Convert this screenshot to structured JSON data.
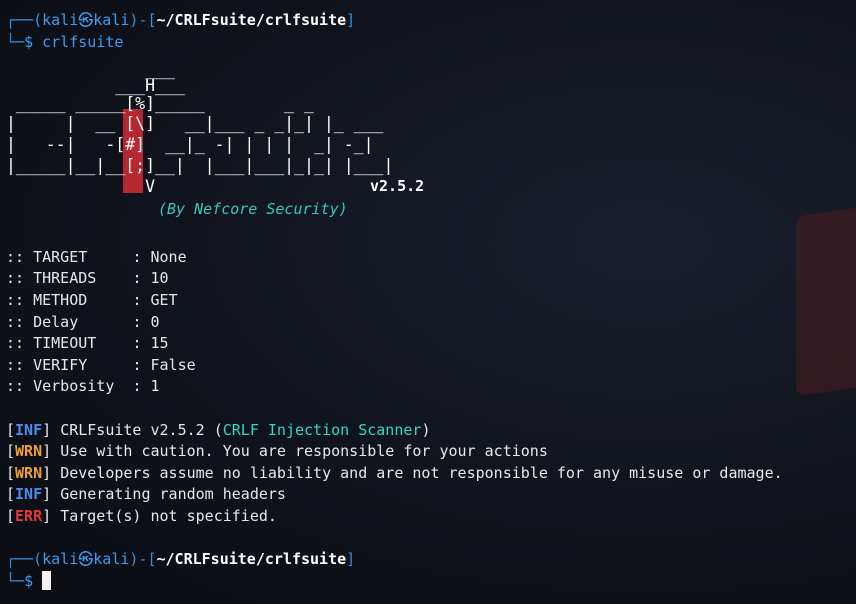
{
  "prompt": {
    "user": "kali",
    "host": "kali",
    "at_symbol": "㉿",
    "path": "~/CRLFsuite/crlfsuite",
    "symbol": "$"
  },
  "command": "crlfsuite",
  "banner": {
    "ascii": [
      "              ___",
      "           ___H___",
      " _____ _____[%]_____        _ _",
      "|     |  __ [\\]   __|___ _ _|_| |_ ___",
      "|   --|   -[#]  __|_ -| | | |  _| -_|",
      "|_____|__|__[;]__|  |___|___|_|_| |___|",
      "              V"
    ],
    "version": "v2.5.2",
    "credit": "(By Nefcore Security)"
  },
  "config": [
    {
      "key": ":: TARGET     ",
      "value": ": None"
    },
    {
      "key": ":: THREADS    ",
      "value": ": 10"
    },
    {
      "key": ":: METHOD     ",
      "value": ": GET"
    },
    {
      "key": ":: Delay      ",
      "value": ": 0"
    },
    {
      "key": ":: TIMEOUT    ",
      "value": ": 15"
    },
    {
      "key": ":: VERIFY     ",
      "value": ": False"
    },
    {
      "key": ":: Verbosity  ",
      "value": ": 1"
    }
  ],
  "logs": [
    {
      "tag": "INF",
      "text": "CRLFsuite v2.5.2 (",
      "highlight": "CRLF Injection Scanner",
      "tail": ")"
    },
    {
      "tag": "WRN",
      "text": "Use with caution. You are responsible for your actions"
    },
    {
      "tag": "WRN",
      "text": "Developers assume no liability and are not responsible for any misuse or damage."
    },
    {
      "tag": "INF",
      "text": "Generating random headers"
    },
    {
      "tag": "ERR",
      "text": "Target(s) not specified."
    }
  ],
  "colors": {
    "background": "#10131b",
    "prompt_blue": "#2f8fe6",
    "prompt_green": "#2ee6a8",
    "inf": "#4d8cf0",
    "wrn": "#f0a030",
    "err": "#e23838",
    "banner_red": "#d01c1c"
  }
}
